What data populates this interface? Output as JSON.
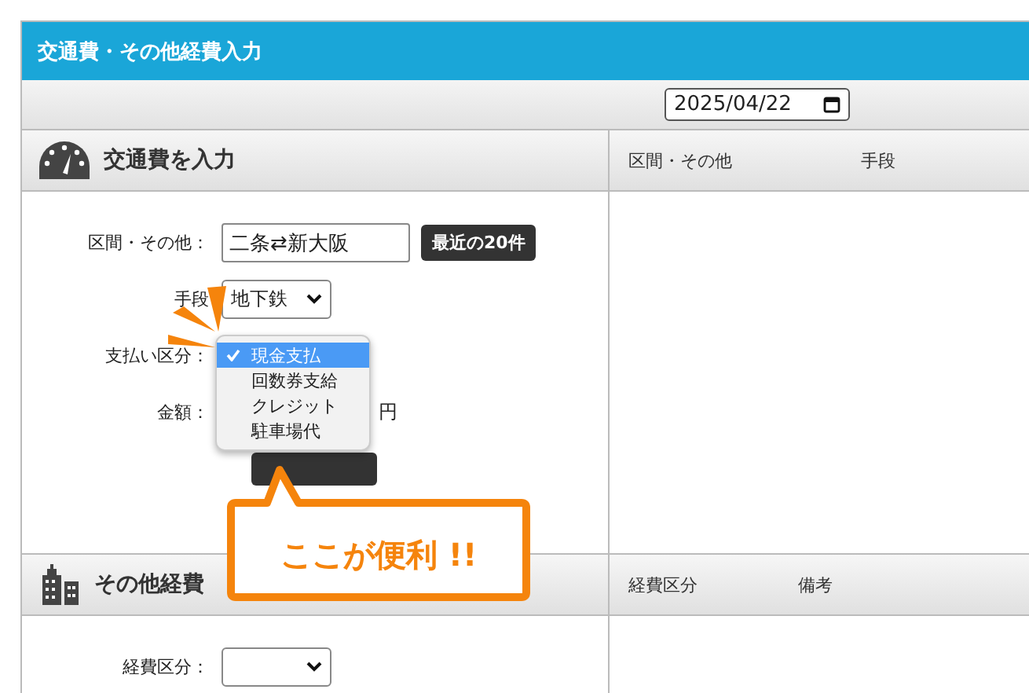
{
  "window": {
    "title": "交通費・その他経費入力"
  },
  "date_field": {
    "value": "2025/04/22"
  },
  "transport": {
    "title": "交通費を入力",
    "fields": [
      {
        "label": "区間・その他：",
        "kind": "text",
        "value": "二条⇄新大阪",
        "button": "最近の20件"
      },
      {
        "label": "手段",
        "kind": "select",
        "value": "地下鉄"
      },
      {
        "label": "支払い区分：",
        "kind": "covered"
      },
      {
        "label": "金額：",
        "kind": "amount",
        "unit": "円"
      }
    ]
  },
  "transport_list": {
    "columns": [
      "区間・その他",
      "手段"
    ]
  },
  "other": {
    "title": "その他経費",
    "fields": [
      {
        "label": "経費区分：",
        "kind": "select"
      }
    ]
  },
  "other_list": {
    "columns": [
      "経費区分",
      "備考"
    ]
  },
  "payment_dropdown": {
    "options": [
      {
        "label": "現金支払",
        "selected": true
      },
      {
        "label": "回数券支給",
        "selected": false
      },
      {
        "label": "クレジット",
        "selected": false
      },
      {
        "label": "駐車場代",
        "selected": false
      }
    ]
  },
  "callout": {
    "text": "ここが便利 !!"
  }
}
